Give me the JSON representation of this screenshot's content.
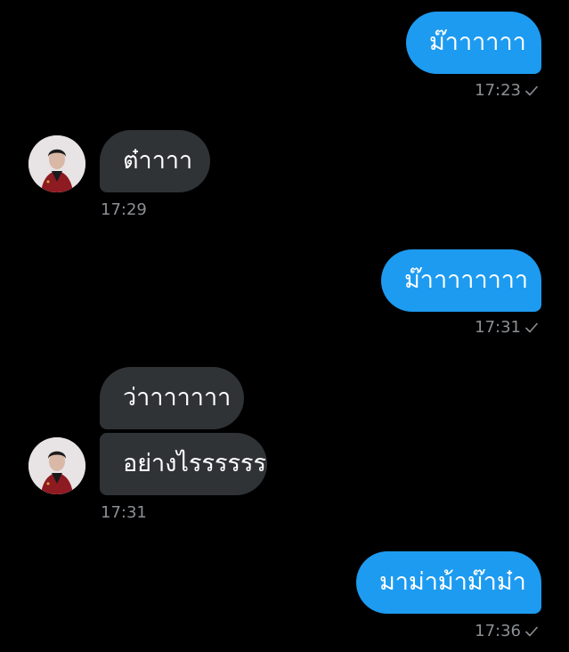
{
  "messages": [
    {
      "direction": "out",
      "text": "ม๊าาาาาา",
      "time": "17:23"
    },
    {
      "direction": "in",
      "text": "ต๋าาาา",
      "time": "17:29"
    },
    {
      "direction": "out",
      "text": "ม๊าาาาาาาา",
      "time": "17:31"
    },
    {
      "direction": "in",
      "text": "ว่าาาาาาา",
      "time": ""
    },
    {
      "direction": "in",
      "text": "อย่างไรรรรรร",
      "time": "17:31"
    },
    {
      "direction": "out",
      "text": "มาม่าม้าม๊าม๋า",
      "time": "17:36"
    }
  ],
  "colors": {
    "outgoing_bubble": "#1d9bf0",
    "incoming_bubble": "#2f3336",
    "timestamp": "#8b8f94",
    "background": "#000000"
  },
  "icons": {
    "read_receipt": "check-icon",
    "contact_avatar": "avatar"
  }
}
